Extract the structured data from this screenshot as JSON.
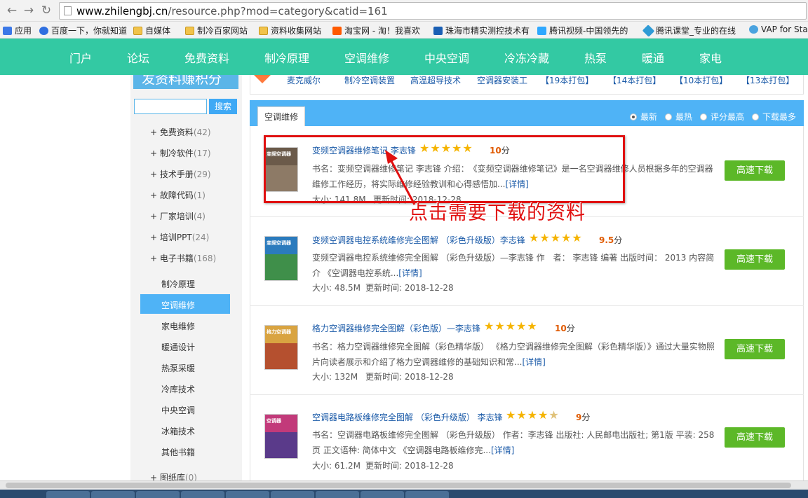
{
  "browser": {
    "url_host": "www.zhilengbj.cn",
    "url_path": "/resource.php?mod=category&catid=161",
    "bookmarks": [
      "应用",
      "百度一下，你就知道",
      "自媒体",
      "制冷百家网站",
      "资料收集网站",
      "淘宝网 - 淘！我喜欢",
      "珠海市精实测控技术有",
      "腾讯视频-中国领先的",
      "腾讯课堂_专业的在线",
      "VAP for Sta"
    ]
  },
  "nav": [
    "门户",
    "论坛",
    "免费资料",
    "制冷原理",
    "空调维修",
    "中央空调",
    "冷冻冷藏",
    "热泵",
    "暖通",
    "家电"
  ],
  "sidebar": {
    "banner": "发资料赚积分",
    "search_button": "搜索",
    "categories": [
      {
        "name": "免费资料",
        "count": "(42)"
      },
      {
        "name": "制冷软件",
        "count": "(17)"
      },
      {
        "name": "技术手册",
        "count": "(29)"
      },
      {
        "name": "故障代码",
        "count": "(1)"
      },
      {
        "name": "厂家培训",
        "count": "(4)"
      },
      {
        "name": "培训PPT",
        "count": "(24)"
      },
      {
        "name": "电子书籍",
        "count": "(168)"
      },
      {
        "name": "图纸库",
        "count": "(0)"
      }
    ],
    "subcategories": [
      "制冷原理",
      "空调维修",
      "家电维修",
      "暖通设计",
      "热泵采暖",
      "冷库技术",
      "中央空调",
      "冰箱技术",
      "其他书籍"
    ]
  },
  "packages": [
    "麦克威尔",
    "制冷空调装置",
    "高温超导技术",
    "空调器安装工",
    "【19本打包】",
    "【14本打包】",
    "【10本打包】",
    "【13本打包】"
  ],
  "tab": "空调维修",
  "sort_options": [
    "最新",
    "最热",
    "评分最高",
    "下载最多"
  ],
  "resources": [
    {
      "title": "变频空调器维修笔记 李志锋",
      "score": "10",
      "score_unit": "分",
      "rating": 5,
      "desc": "书名：变频空调器维修笔记 李志锋 介绍：　《变频空调器维修笔记》是一名空调器维修人员根据多年的空调器维修工作经历，将实际维修经验教训和心得感悟加...",
      "more": "[详情]",
      "size": "大小: 141.8M",
      "updated": "更新时间: 2018-12-28",
      "button": "高速下载",
      "thumb_title": "变频空调器"
    },
    {
      "title": "变频空调器电控系统维修完全图解 （彩色升级版）李志锋",
      "score": "9.5",
      "score_unit": "分",
      "rating": 5,
      "desc": "变频空调器电控系统维修完全图解 （彩色升级版）—李志锋 作　者： 李志锋 编著 出版时间： 2013 内容简介 《空调器电控系统...",
      "more": "[详情]",
      "size": "大小: 48.5M",
      "updated": "更新时间: 2018-12-28",
      "button": "高速下载",
      "thumb_title": "变频空调器"
    },
    {
      "title": "格力空调器维修完全图解（彩色版）—李志锋",
      "score": "10",
      "score_unit": "分",
      "rating": 5,
      "desc": "书名：格力空调器维修完全图解（彩色精华版） 《格力空调器维修完全图解（彩色精华版）》通过大量实物照片向读者展示和介绍了格力空调器维修的基础知识和常...",
      "more": "[详情]",
      "size": "大小: 132M",
      "updated": "更新时间: 2018-12-28",
      "button": "高速下载",
      "thumb_title": "格力空调器"
    },
    {
      "title": "空调器电路板维修完全图解 （彩色升级版） 李志锋",
      "score": "9",
      "score_unit": "分",
      "rating": 4.5,
      "desc": "书名：空调器电路板维修完全图解 （彩色升级版） 作者：李志锋 出版社: 人民邮电出版社; 第1版 平装: 258页 正文语种: 简体中文 《空调器电路板维修完...",
      "more": "[详情]",
      "size": "大小: 61.2M",
      "updated": "更新时间: 2018-12-28",
      "button": "高速下载",
      "thumb_title": "空调器"
    }
  ],
  "annotation": "点击需要下载的资料",
  "colors": {
    "nav_green": "#33c9a3",
    "accent_blue": "#4fb3f6",
    "download_green": "#5cb828",
    "annot_red": "#e01010",
    "star": "#f5b400"
  }
}
